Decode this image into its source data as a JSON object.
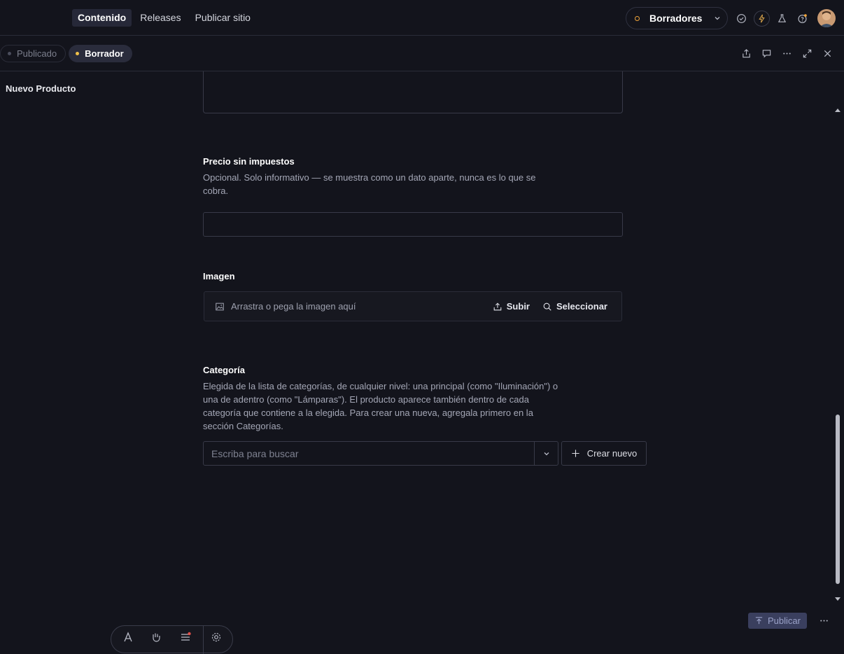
{
  "nav": {
    "tabs": [
      "Contenido",
      "Releases",
      "Publicar sitio"
    ]
  },
  "perspective": {
    "label": "Borradores"
  },
  "status_chips": {
    "published": "Publicado",
    "draft": "Borrador"
  },
  "document": {
    "title": "Nuevo Producto"
  },
  "fields": {
    "precio": {
      "title": "Precio sin impuestos",
      "description": "Opcional. Solo informativo — se muestra como un dato aparte, nunca es lo que se cobra.",
      "value": ""
    },
    "imagen": {
      "title": "Imagen",
      "placeholder": "Arrastra o pega la imagen aquí",
      "upload_label": "Subir",
      "select_label": "Seleccionar"
    },
    "categoria": {
      "title": "Categoría",
      "description": "Elegida de la lista de categorías, de cualquier nivel: una principal (como \"Iluminación\") o una de adentro (como \"Lámparas\"). El producto aparece también dentro de cada categoría que contiene a la elegida. Para crear una nueva, agregala primero en la sección Categorías.",
      "search_placeholder": "Escriba para buscar",
      "create_label": "Crear nuevo"
    }
  },
  "footer": {
    "publish_label": "Publicar"
  },
  "colors": {
    "accent_draft": "#f0c04a",
    "accent_ring": "#f0a43a",
    "publish_bg": "#3a3f5e"
  }
}
